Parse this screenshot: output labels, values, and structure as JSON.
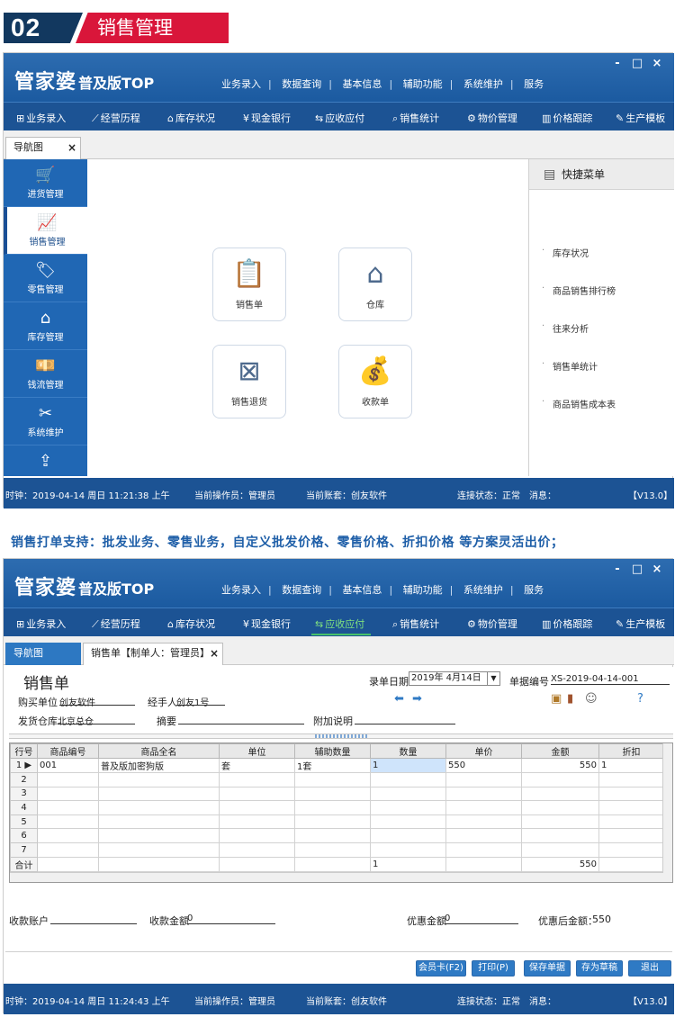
{
  "banner": {
    "number": "02",
    "title": "销售管理"
  },
  "app": {
    "logo": "管家婆",
    "edition": "普及版TOP",
    "window_buttons": [
      "-",
      "□",
      "×"
    ],
    "top_menu": [
      "业务录入",
      "数据查询",
      "基本信息",
      "辅助功能",
      "系统维护",
      "服务"
    ],
    "toolbar": [
      {
        "icon": "barcode-icon",
        "glyph": "⊞",
        "label": "业务录入"
      },
      {
        "icon": "chart-icon",
        "glyph": "⟋",
        "label": "经营历程"
      },
      {
        "icon": "home-icon",
        "glyph": "⌂",
        "label": "库存状况"
      },
      {
        "icon": "yen-icon",
        "glyph": "¥",
        "label": "现金银行"
      },
      {
        "icon": "exchange-icon",
        "glyph": "⇆",
        "label": "应收应付"
      },
      {
        "icon": "search-icon",
        "glyph": "⌕",
        "label": "销售统计"
      },
      {
        "icon": "gear-icon",
        "glyph": "⚙",
        "label": "物价管理"
      },
      {
        "icon": "bars-icon",
        "glyph": "▥",
        "label": "价格跟踪"
      },
      {
        "icon": "wrench-icon",
        "glyph": "✎",
        "label": "生产模板"
      }
    ]
  },
  "screen1": {
    "tab": {
      "label": "导航图",
      "close": "×"
    },
    "sidebar": [
      {
        "icon": "cart-icon",
        "glyph": "🛒",
        "label": "进货管理"
      },
      {
        "icon": "trend-icon",
        "glyph": "📈",
        "label": "销售管理"
      },
      {
        "icon": "tag-icon",
        "glyph": "🏷",
        "label": "零售管理"
      },
      {
        "icon": "house-icon",
        "glyph": "⌂",
        "label": "库存管理"
      },
      {
        "icon": "money-icon",
        "glyph": "💴",
        "label": "钱流管理"
      },
      {
        "icon": "tools-icon",
        "glyph": "✂",
        "label": "系统维护"
      },
      {
        "icon": "export-icon",
        "glyph": "⇪",
        "label": ""
      }
    ],
    "tiles": [
      {
        "icon": "clipboard-icon",
        "glyph": "📋",
        "label": "销售单"
      },
      {
        "icon": "warehouse-icon",
        "glyph": "⌂",
        "label": "仓库"
      },
      {
        "icon": "return-icon",
        "glyph": "⊠",
        "label": "销售退货"
      },
      {
        "icon": "moneybag-icon",
        "glyph": "💰",
        "label": "收款单"
      }
    ],
    "quick_menu": {
      "title": "快捷菜单",
      "items": [
        "库存状况",
        "商品销售排行榜",
        "往来分析",
        "销售单统计",
        "商品销售成本表"
      ]
    },
    "status": {
      "clock": "时钟：2019-04-14 周日 11:21:38 上午",
      "operator": "当前操作员：管理员",
      "account": "当前账套：创友软件",
      "connection": "连接状态：正常",
      "message": "消息：",
      "version": "【V13.0】"
    }
  },
  "tagline": "销售打单支持：批发业务、零售业务，自定义批发价格、零售价格、折扣价格 等方案灵活出价；",
  "screen2": {
    "tabs": [
      {
        "label": "导航图",
        "close": ""
      },
      {
        "label": "销售单【制单人：管理员】",
        "close": "×"
      }
    ],
    "form": {
      "title": "销售单",
      "date_label": "录单日期",
      "date_value": "2019年 4月14日",
      "bill_no_label": "单据编号",
      "bill_no_value": "XS-2019-04-14-001",
      "buyer_label": "购买单位",
      "buyer_value": "创友软件",
      "handler_label": "经手人",
      "handler_value": "创友1号",
      "warehouse_label": "发货仓库",
      "warehouse_value": "北京总仓",
      "summary_label": "摘要",
      "summary_value": "",
      "note_label": "附加说明",
      "note_value": ""
    },
    "grid": {
      "headers": [
        "行号",
        "商品编号",
        "商品全名",
        "单位",
        "辅助数量",
        "数量",
        "单价",
        "金额",
        "折扣"
      ],
      "rows": [
        [
          "1",
          "001",
          "普及版加密狗版",
          "套",
          "1套",
          "1",
          "550",
          "550",
          "1"
        ],
        [
          "2",
          "",
          "",
          "",
          "",
          "",
          "",
          "",
          ""
        ],
        [
          "3",
          "",
          "",
          "",
          "",
          "",
          "",
          "",
          ""
        ],
        [
          "4",
          "",
          "",
          "",
          "",
          "",
          "",
          "",
          ""
        ],
        [
          "5",
          "",
          "",
          "",
          "",
          "",
          "",
          "",
          ""
        ],
        [
          "6",
          "",
          "",
          "",
          "",
          "",
          "",
          "",
          ""
        ],
        [
          "7",
          "",
          "",
          "",
          "",
          "",
          "",
          "",
          ""
        ]
      ],
      "total": [
        "合计",
        "",
        "",
        "",
        "",
        "1",
        "",
        "550",
        ""
      ]
    },
    "footer": {
      "account_label": "收款账户",
      "account_value": "",
      "amount_label": "收款金额",
      "amount_value": "0",
      "discount_label": "优惠金额",
      "discount_value": "0",
      "after_label": "优惠后金额：",
      "after_value": "550"
    },
    "buttons": [
      "会员卡(F2)",
      "打印(P)",
      "保存单据",
      "存为草稿",
      "退出"
    ],
    "status": {
      "clock": "时钟：2019-04-14 周日 11:24:43 上午",
      "operator": "当前操作员：管理员",
      "account": "当前账套：创友软件",
      "connection": "连接状态：正常",
      "message": "消息：",
      "version": "【V13.0】"
    }
  }
}
